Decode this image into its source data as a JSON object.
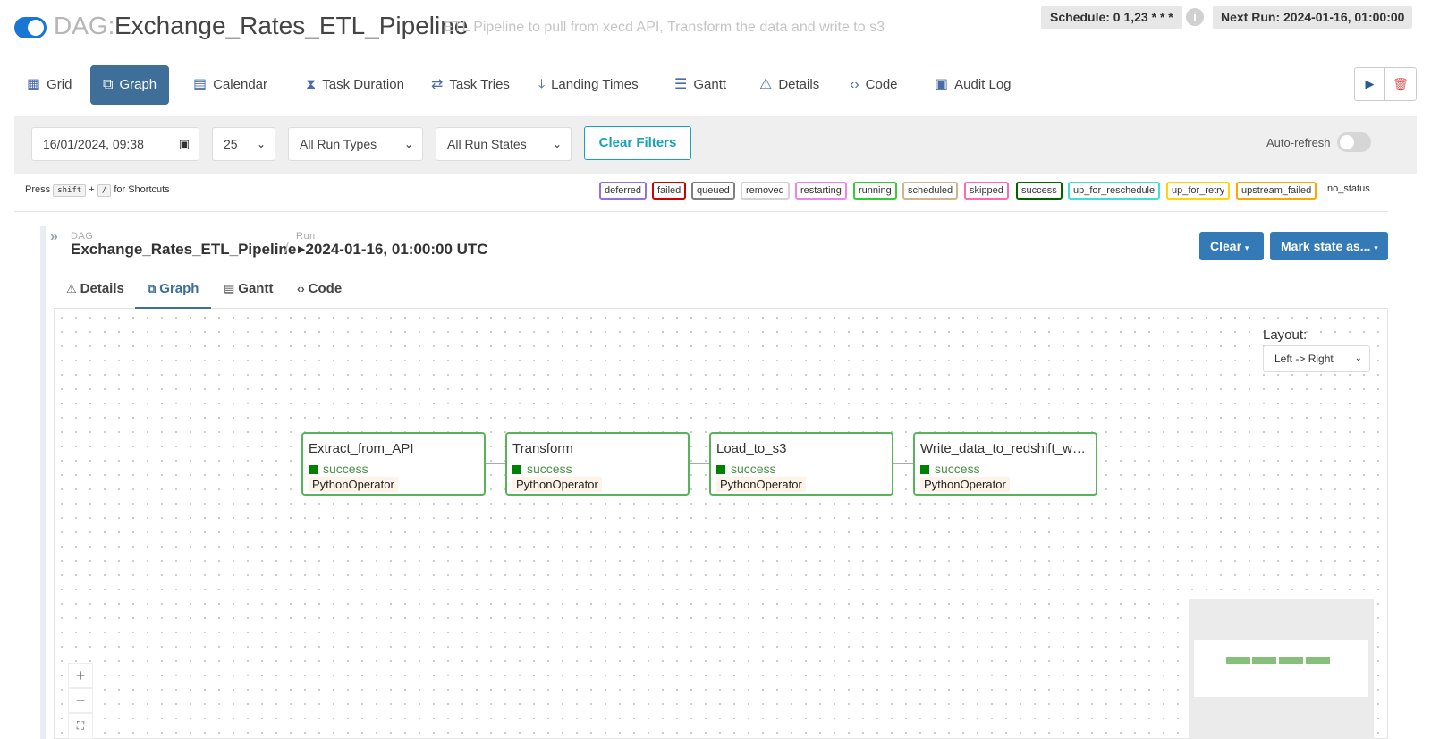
{
  "header": {
    "dag_label": "DAG:",
    "dag_name": "Exchange_Rates_ETL_Pipeline",
    "description": "ETL Pipeline to pull from xecd API, Transform the data and write to s3",
    "schedule": "Schedule: 0 1,23 * * *",
    "next_run": "Next Run: 2024-01-16, 01:00:00",
    "paused": false
  },
  "tabs": [
    {
      "label": "Grid",
      "icon": "grid-icon"
    },
    {
      "label": "Graph",
      "icon": "graph-icon",
      "active": true
    },
    {
      "label": "Calendar",
      "icon": "calendar-icon"
    },
    {
      "label": "Task Duration",
      "icon": "hourglass-icon"
    },
    {
      "label": "Task Tries",
      "icon": "retry-icon"
    },
    {
      "label": "Landing Times",
      "icon": "landing-icon"
    },
    {
      "label": "Gantt",
      "icon": "gantt-icon"
    },
    {
      "label": "Details",
      "icon": "warning-icon"
    },
    {
      "label": "Code",
      "icon": "code-icon"
    },
    {
      "label": "Audit Log",
      "icon": "audit-icon"
    }
  ],
  "filters": {
    "datetime": "16/01/2024, 09:38",
    "num_runs": "25",
    "run_type": "All Run Types",
    "run_state": "All Run States",
    "clear_label": "Clear Filters",
    "autorefresh_label": "Auto-refresh",
    "autorefresh_on": false
  },
  "shortcut": {
    "prefix": "Press",
    "key1": "shift",
    "plus": "+",
    "key2": "/",
    "suffix": "for Shortcuts"
  },
  "legend": [
    {
      "label": "deferred",
      "color": "#9370db"
    },
    {
      "label": "failed",
      "color": "#d00000"
    },
    {
      "label": "queued",
      "color": "#808080"
    },
    {
      "label": "removed",
      "color": "#d3d3d3"
    },
    {
      "label": "restarting",
      "color": "#ee82ee"
    },
    {
      "label": "running",
      "color": "#32cd32"
    },
    {
      "label": "scheduled",
      "color": "#d2b48c"
    },
    {
      "label": "skipped",
      "color": "#ff69b4"
    },
    {
      "label": "success",
      "color": "#006400"
    },
    {
      "label": "up_for_reschedule",
      "color": "#40e0d0"
    },
    {
      "label": "up_for_retry",
      "color": "#ffd700"
    },
    {
      "label": "upstream_failed",
      "color": "#ffa500"
    },
    {
      "label": "no_status",
      "color": "#ffffff"
    }
  ],
  "breadcrumb": {
    "dag_small": "DAG",
    "dag_name": "Exchange_Rates_ETL_Pipeline",
    "separator": "/",
    "run_small": "Run",
    "run_value": "2024-01-16, 01:00:00 UTC"
  },
  "actions": {
    "clear": "Clear",
    "mark_state": "Mark state as..."
  },
  "subtabs": [
    {
      "label": "Details",
      "icon": "warning-icon"
    },
    {
      "label": "Graph",
      "icon": "graph-icon",
      "active": true
    },
    {
      "label": "Gantt",
      "icon": "gantt-icon"
    },
    {
      "label": "Code",
      "icon": "code-icon"
    }
  ],
  "graph": {
    "layout_label": "Layout:",
    "layout_value": "Left -> Right",
    "nodes": [
      {
        "name": "Extract_from_API",
        "state": "success",
        "operator": "PythonOperator"
      },
      {
        "name": "Transform",
        "state": "success",
        "operator": "PythonOperator"
      },
      {
        "name": "Load_to_s3",
        "state": "success",
        "operator": "PythonOperator"
      },
      {
        "name": "Write_data_to_redshift_warehouse",
        "state": "success",
        "operator": "PythonOperator"
      }
    ],
    "zoom_in": "+",
    "zoom_out": "−",
    "fit": "⛶"
  },
  "colors": {
    "accent": "#3f6e99",
    "primary": "#337ab7",
    "success_border": "#59b35a",
    "teal": "#17a2b8"
  }
}
